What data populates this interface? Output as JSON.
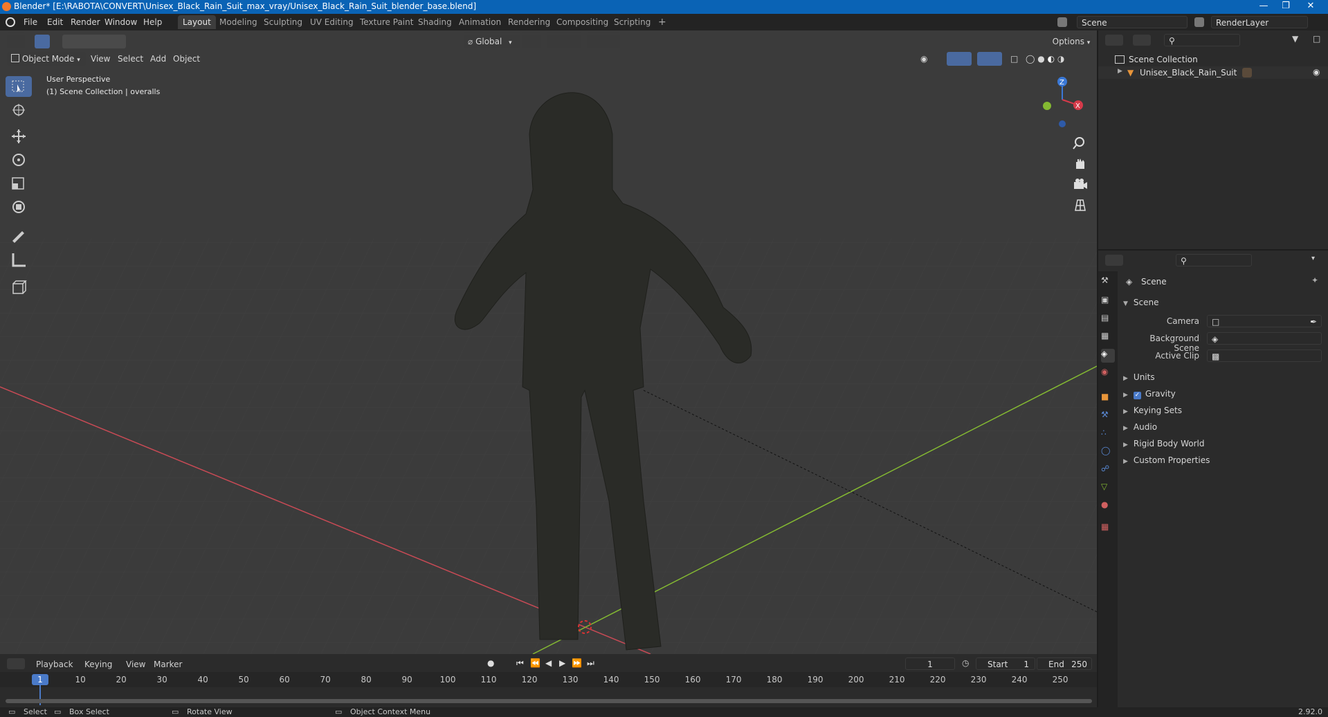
{
  "window": {
    "title": "Blender* [E:\\RABOTA\\CONVERT\\Unisex_Black_Rain_Suit_max_vray/Unisex_Black_Rain_Suit_blender_base.blend]"
  },
  "menu": [
    "File",
    "Edit",
    "Render",
    "Window",
    "Help"
  ],
  "workspaces": {
    "active": "Layout",
    "tabs": [
      "Layout",
      "Modeling",
      "Sculpting",
      "UV Editing",
      "Texture Paint",
      "Shading",
      "Animation",
      "Rendering",
      "Compositing",
      "Scripting"
    ]
  },
  "scene_selector": {
    "value": "Scene"
  },
  "layer_selector": {
    "value": "RenderLayer"
  },
  "viewport": {
    "transform_orientation": "Global",
    "options_label": "Options",
    "mode": "Object Mode",
    "header_menus": [
      "View",
      "Select",
      "Add",
      "Object"
    ],
    "overlay_line1": "User Perspective",
    "overlay_line2": "(1) Scene Collection | overalls",
    "gizmo": {
      "z": "Z",
      "x": "X"
    }
  },
  "outliner": {
    "root": "Scene Collection",
    "items": [
      {
        "label": "Unisex_Black_Rain_Suit"
      }
    ]
  },
  "properties": {
    "header": "Scene",
    "section": "Scene",
    "fields": {
      "camera_label": "Camera",
      "background_scene_label": "Background Scene",
      "active_clip_label": "Active Clip"
    },
    "panels": [
      "Units",
      "Gravity",
      "Keying Sets",
      "Audio",
      "Rigid Body World",
      "Custom Properties"
    ],
    "gravity_checked": true
  },
  "timeline": {
    "menus": [
      "Playback",
      "Keying",
      "View",
      "Marker"
    ],
    "current_frame": "1",
    "start_label": "Start",
    "start_value": "1",
    "end_label": "End",
    "end_value": "250",
    "ticks": [
      "1",
      "10",
      "20",
      "30",
      "40",
      "50",
      "60",
      "70",
      "80",
      "90",
      "100",
      "110",
      "120",
      "130",
      "140",
      "150",
      "160",
      "170",
      "180",
      "190",
      "200",
      "210",
      "220",
      "230",
      "240",
      "250"
    ]
  },
  "statusbar": {
    "select": "Select",
    "box_select": "Box Select",
    "rotate_view": "Rotate View",
    "context_menu": "Object Context Menu",
    "version": "2.92.0"
  },
  "colors": {
    "accent": "#4a6aa0",
    "titlebar": "#0a63b5",
    "x_axis": "#d63a4a",
    "y_axis": "#84b932",
    "z_axis": "#3a78d6"
  }
}
